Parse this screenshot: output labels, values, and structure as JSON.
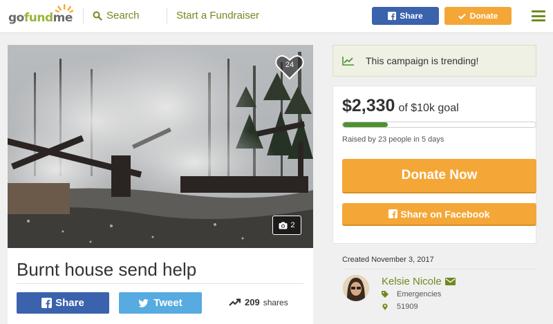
{
  "header": {
    "logo": {
      "text_a": "go",
      "text_b": "fund",
      "text_c": "me"
    },
    "search_label": "Search",
    "start_label": "Start a Fundraiser",
    "share_label": "Share",
    "donate_label": "Donate",
    "colors": {
      "brand_green": "#6e8a1f",
      "facebook_blue": "#3a62ad",
      "donate_orange": "#f4a737"
    }
  },
  "campaign": {
    "likes": "24",
    "photo_count": "2",
    "title": "Burnt house send help",
    "share_fb_label": "Share",
    "tweet_label": "Tweet",
    "shares_count": "209",
    "shares_label": "shares"
  },
  "sidebar": {
    "trending_text": "This campaign is trending!",
    "raised_amount": "$2,330",
    "goal_text": "of $10k goal",
    "progress_fraction": 0.233,
    "raised_by_text": "Raised by 23 people in 5 days",
    "donate_now_label": "Donate Now",
    "share_facebook_label": "Share on Facebook",
    "created_text": "Created November 3, 2017",
    "organizer_name": "Kelsie Nicole",
    "category": "Emergencies",
    "location": "51909"
  }
}
